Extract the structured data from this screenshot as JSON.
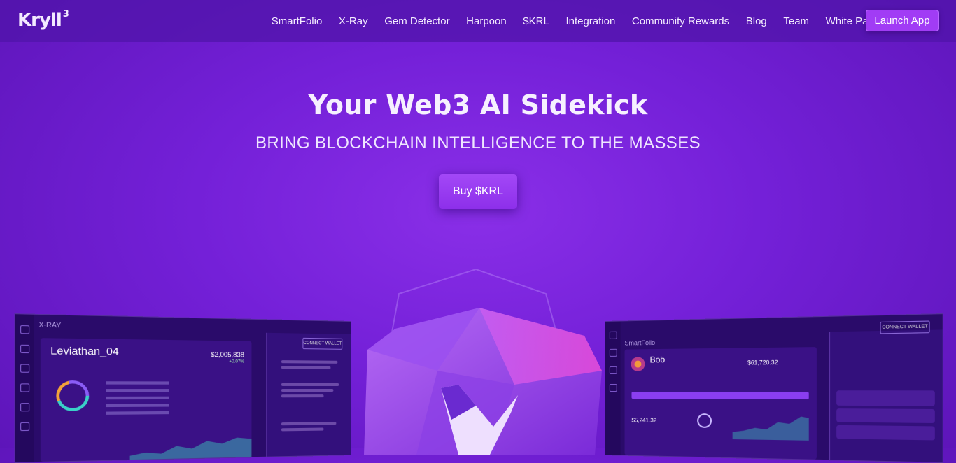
{
  "brand": {
    "name": "Kryll",
    "superscript": "3"
  },
  "nav": {
    "items": [
      "SmartFolio",
      "X-Ray",
      "Gem Detector",
      "Harpoon",
      "$KRL",
      "Integration",
      "Community Rewards",
      "Blog",
      "Team",
      "White Paper"
    ],
    "cta": "Launch App"
  },
  "hero": {
    "title": "Your Web3 AI Sidekick",
    "subtitle": "BRING BLOCKCHAIN INTELLIGENCE TO THE MASSES",
    "button": "Buy $KRL"
  },
  "left_panel": {
    "app_label": "X-RAY",
    "wallet_name": "Leviathan_04",
    "balance": "$2,005,838",
    "change": "+0.07%",
    "connect": "CONNECT WALLET"
  },
  "right_panel": {
    "app_label": "SmartFolio",
    "user_name": "Bob",
    "balance": "$61,720.32",
    "sub_balance": "$5,241.32",
    "connect": "CONNECT WALLET"
  },
  "colors": {
    "accent": "#a13cf5",
    "background": "#7420d8",
    "panel": "#2a0b6a"
  }
}
